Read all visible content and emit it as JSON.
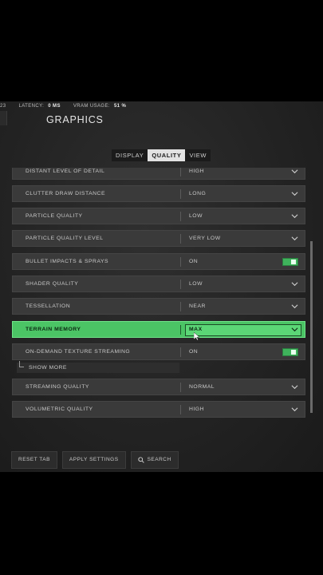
{
  "topbar": {
    "fragment": "23",
    "latency_label": "LATENCY:",
    "latency_value": "0 MS",
    "vram_label": "VRAM USAGE:",
    "vram_value": "51 %"
  },
  "page": {
    "title": "GRAPHICS"
  },
  "tabs": [
    {
      "label": "DISPLAY",
      "active": false
    },
    {
      "label": "QUALITY",
      "active": true
    },
    {
      "label": "VIEW",
      "active": false
    }
  ],
  "settings": [
    {
      "label": "DISTANT LEVEL OF DETAIL",
      "value": "HIGH",
      "control": "dropdown"
    },
    {
      "label": "CLUTTER DRAW DISTANCE",
      "value": "LONG",
      "control": "dropdown"
    },
    {
      "label": "PARTICLE QUALITY",
      "value": "LOW",
      "control": "dropdown"
    },
    {
      "label": "PARTICLE QUALITY LEVEL",
      "value": "VERY LOW",
      "control": "dropdown"
    },
    {
      "label": "BULLET IMPACTS & SPRAYS",
      "value": "ON",
      "control": "toggle"
    },
    {
      "label": "SHADER QUALITY",
      "value": "LOW",
      "control": "dropdown"
    },
    {
      "label": "TESSELLATION",
      "value": "NEAR",
      "control": "dropdown"
    },
    {
      "label": "TERRAIN MEMORY",
      "value": "MAX",
      "control": "dropdown",
      "highlighted": true
    },
    {
      "label": "ON-DEMAND TEXTURE STREAMING",
      "value": "ON",
      "control": "toggle"
    },
    {
      "label": "STREAMING QUALITY",
      "value": "NORMAL",
      "control": "dropdown"
    },
    {
      "label": "VOLUMETRIC QUALITY",
      "value": "HIGH",
      "control": "dropdown"
    }
  ],
  "show_more": {
    "label": "SHOW MORE"
  },
  "buttons": {
    "reset": "RESET TAB",
    "apply": "APPLY SETTINGS",
    "search": "SEARCH"
  },
  "colors": {
    "accent_green": "#4bc465",
    "toggle_green": "#3fb35c",
    "row_bg": "#3a3a3a"
  },
  "icons": {
    "dropdown": "chevron-down-icon",
    "search": "search-icon"
  }
}
